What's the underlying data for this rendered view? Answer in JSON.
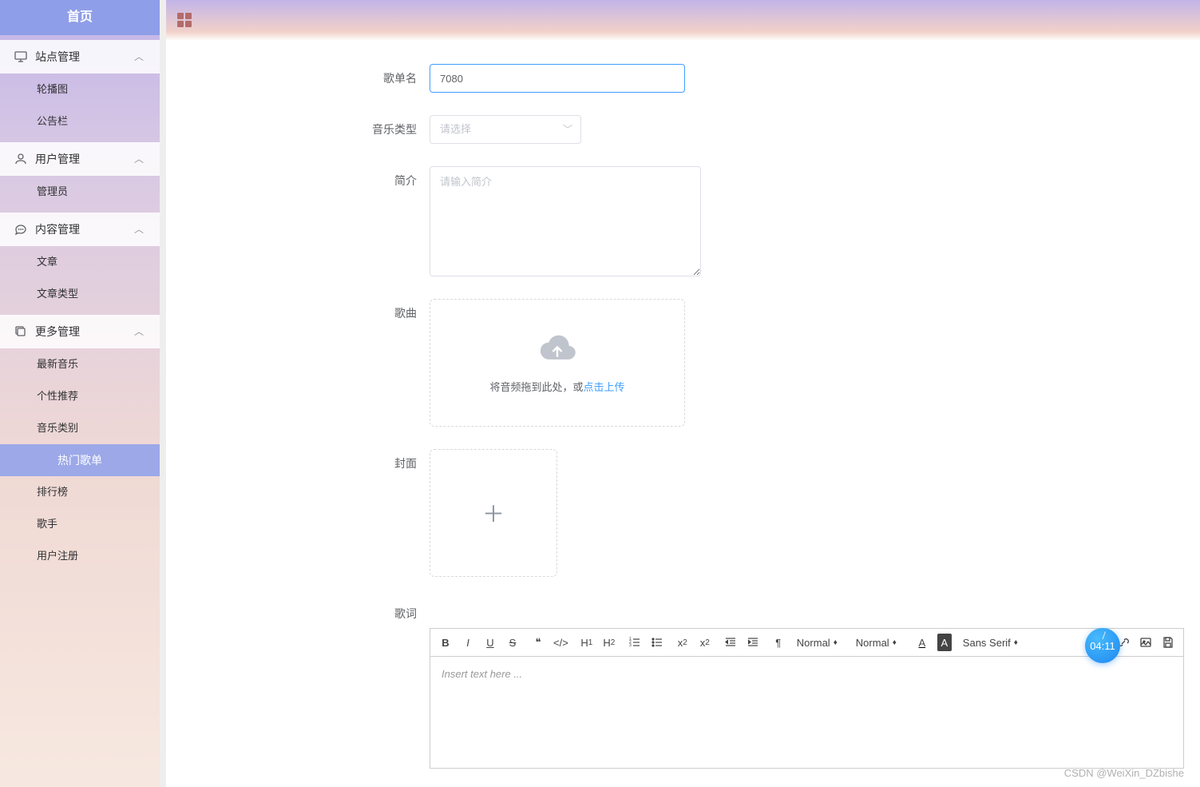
{
  "sidebar": {
    "home": "首页",
    "groups": [
      {
        "icon": "monitor",
        "label": "站点管理",
        "items": [
          "轮播图",
          "公告栏"
        ]
      },
      {
        "icon": "user",
        "label": "用户管理",
        "items": [
          "管理员"
        ]
      },
      {
        "icon": "chat",
        "label": "内容管理",
        "items": [
          "文章",
          "文章类型"
        ]
      },
      {
        "icon": "copy",
        "label": "更多管理",
        "items": [
          "最新音乐",
          "个性推荐",
          "音乐类别",
          "热门歌单",
          "排行榜",
          "歌手",
          "用户注册"
        ]
      }
    ],
    "activeItem": "热门歌单"
  },
  "form": {
    "name_label": "歌单名",
    "name_value": "7080",
    "type_label": "音乐类型",
    "type_placeholder": "请选择",
    "intro_label": "简介",
    "intro_placeholder": "请输入简介",
    "song_label": "歌曲",
    "upload_text_prefix": "将音频拖到此处，或",
    "upload_link": "点击上传",
    "cover_label": "封面",
    "lyric_label": "歌词"
  },
  "editor": {
    "placeholder": "Insert text here ...",
    "header_normal": "Normal",
    "size_normal": "Normal",
    "font": "Sans Serif"
  },
  "clock": "04:11",
  "watermark": "CSDN @WeiXin_DZbishe"
}
